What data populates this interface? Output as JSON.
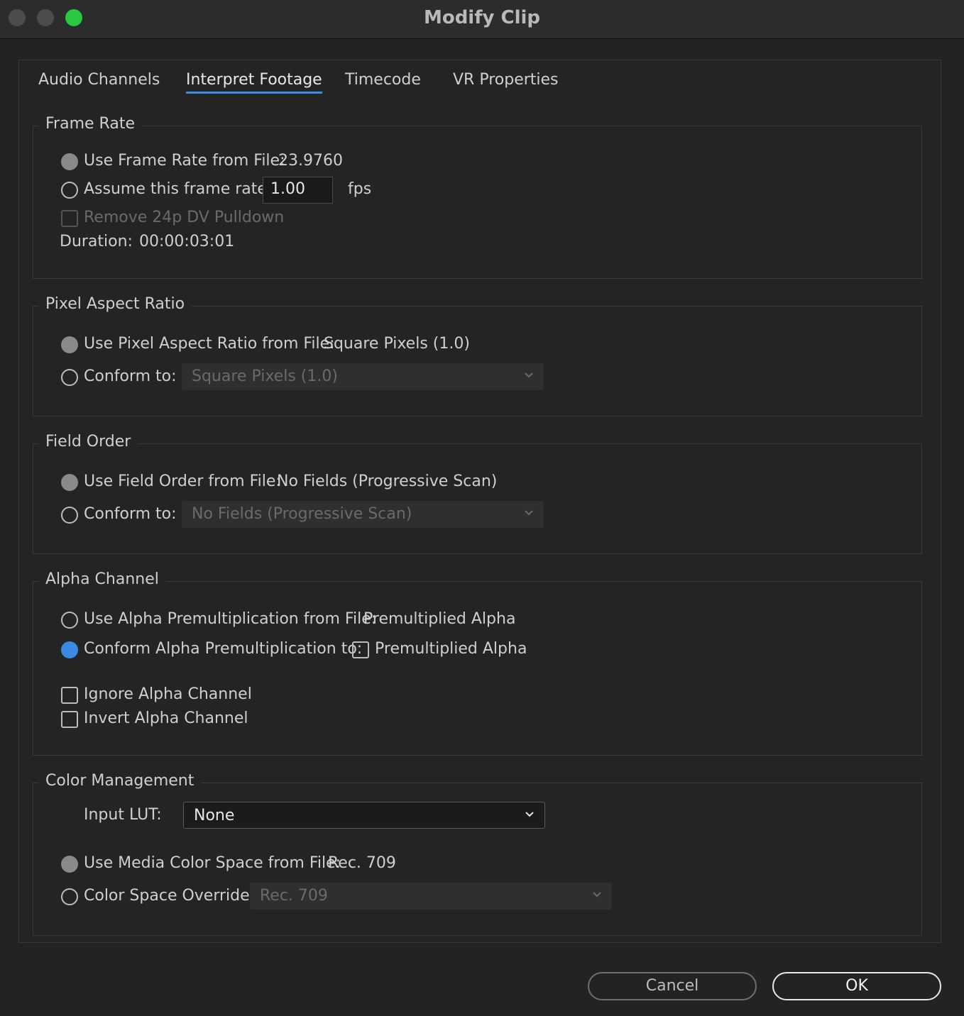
{
  "window": {
    "title": "Modify Clip"
  },
  "tabs": [
    "Audio Channels",
    "Interpret Footage",
    "Timecode",
    "VR Properties"
  ],
  "frame_rate": {
    "legend": "Frame Rate",
    "use_from_file_label": "Use Frame Rate from File:",
    "use_from_file_value": "23.9760",
    "assume_label": "Assume this frame rate:",
    "assume_value": "1.00",
    "fps_label": "fps",
    "remove_pulldown_label": "Remove 24p DV Pulldown",
    "duration_label": "Duration:",
    "duration_value": "00:00:03:01"
  },
  "pixel_aspect": {
    "legend": "Pixel Aspect Ratio",
    "use_from_file_label": "Use Pixel Aspect Ratio from File:",
    "use_from_file_value": "Square Pixels (1.0)",
    "conform_label": "Conform to:",
    "conform_value": "Square Pixels (1.0)"
  },
  "field_order": {
    "legend": "Field Order",
    "use_from_file_label": "Use Field Order from File:",
    "use_from_file_value": "No Fields (Progressive Scan)",
    "conform_label": "Conform to:",
    "conform_value": "No Fields (Progressive Scan)"
  },
  "alpha": {
    "legend": "Alpha Channel",
    "use_from_file_label": "Use Alpha Premultiplication from File:",
    "use_from_file_value": "Premultiplied Alpha",
    "conform_label": "Conform Alpha Premultiplication to:",
    "conform_check_label": "Premultiplied Alpha",
    "ignore_label": "Ignore Alpha Channel",
    "invert_label": "Invert Alpha Channel"
  },
  "color": {
    "legend": "Color Management",
    "input_lut_label": "Input LUT:",
    "input_lut_value": "None",
    "use_from_file_label": "Use Media Color Space from File:",
    "use_from_file_value": "Rec. 709",
    "override_label": "Color Space Override:",
    "override_value": "Rec. 709"
  },
  "buttons": {
    "cancel": "Cancel",
    "ok": "OK"
  },
  "colors": {
    "accent": "#3b8be5",
    "traffic_max": "#28c840"
  }
}
